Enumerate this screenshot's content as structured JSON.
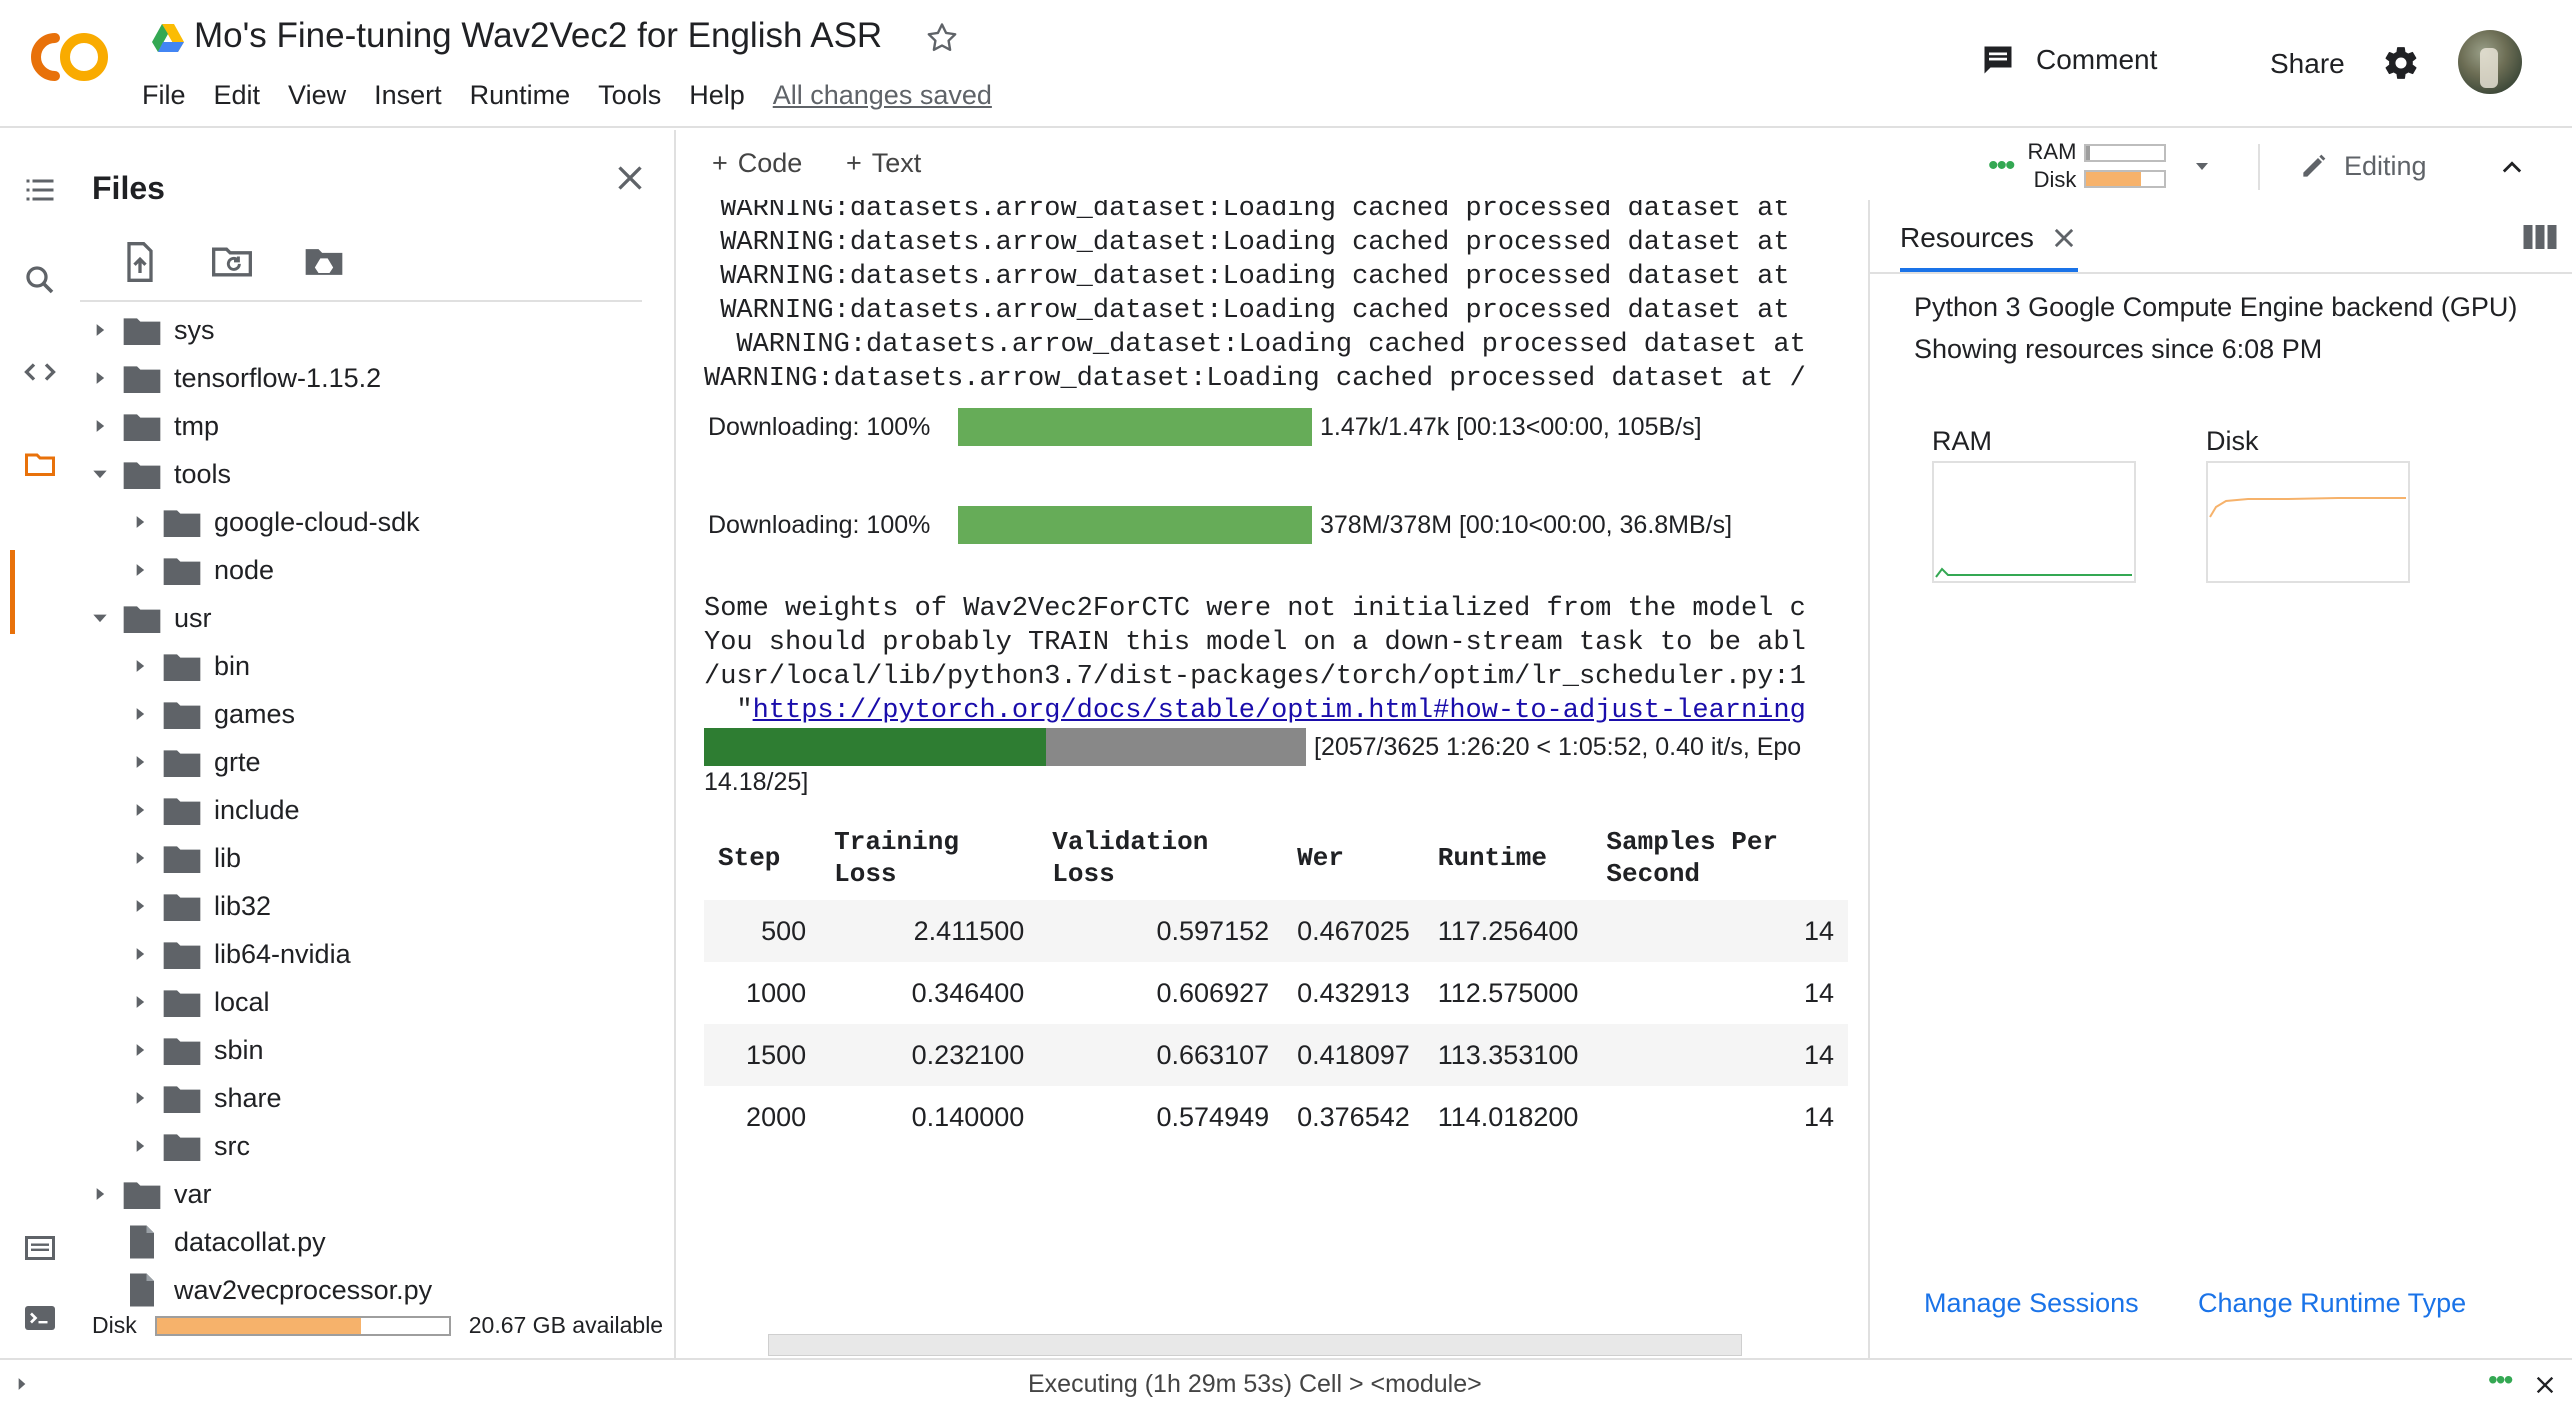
{
  "header": {
    "logo": "colab-logo",
    "title": "Mo's Fine-tuning Wav2Vec2 for English ASR",
    "menu": [
      "File",
      "Edit",
      "View",
      "Insert",
      "Runtime",
      "Tools",
      "Help"
    ],
    "save_status": "All changes saved",
    "comment_label": "Comment",
    "share_label": "Share"
  },
  "files": {
    "title": "Files",
    "tree": [
      {
        "label": "sys",
        "depth": 0,
        "type": "folder",
        "state": "collapsed"
      },
      {
        "label": "tensorflow-1.15.2",
        "depth": 0,
        "type": "folder",
        "state": "collapsed"
      },
      {
        "label": "tmp",
        "depth": 0,
        "type": "folder",
        "state": "collapsed"
      },
      {
        "label": "tools",
        "depth": 0,
        "type": "folder",
        "state": "expanded"
      },
      {
        "label": "google-cloud-sdk",
        "depth": 1,
        "type": "folder",
        "state": "collapsed"
      },
      {
        "label": "node",
        "depth": 1,
        "type": "folder",
        "state": "collapsed"
      },
      {
        "label": "usr",
        "depth": 0,
        "type": "folder",
        "state": "expanded"
      },
      {
        "label": "bin",
        "depth": 1,
        "type": "folder",
        "state": "collapsed"
      },
      {
        "label": "games",
        "depth": 1,
        "type": "folder",
        "state": "collapsed"
      },
      {
        "label": "grte",
        "depth": 1,
        "type": "folder",
        "state": "collapsed"
      },
      {
        "label": "include",
        "depth": 1,
        "type": "folder",
        "state": "collapsed"
      },
      {
        "label": "lib",
        "depth": 1,
        "type": "folder",
        "state": "collapsed"
      },
      {
        "label": "lib32",
        "depth": 1,
        "type": "folder",
        "state": "collapsed"
      },
      {
        "label": "lib64-nvidia",
        "depth": 1,
        "type": "folder",
        "state": "collapsed"
      },
      {
        "label": "local",
        "depth": 1,
        "type": "folder",
        "state": "collapsed"
      },
      {
        "label": "sbin",
        "depth": 1,
        "type": "folder",
        "state": "collapsed"
      },
      {
        "label": "share",
        "depth": 1,
        "type": "folder",
        "state": "collapsed"
      },
      {
        "label": "src",
        "depth": 1,
        "type": "folder",
        "state": "collapsed"
      },
      {
        "label": "var",
        "depth": 0,
        "type": "folder",
        "state": "collapsed"
      },
      {
        "label": "datacollat.py",
        "depth": 0,
        "type": "file"
      },
      {
        "label": "wav2vecprocessor.py",
        "depth": 0,
        "type": "file"
      }
    ],
    "disk_label": "Disk",
    "disk_used_fraction": 0.7,
    "disk_available": "20.67 GB available"
  },
  "toolbar": {
    "add_code": "Code",
    "add_text": "Text",
    "ram_label": "RAM",
    "disk_label": "Disk",
    "ram_fraction": 0.05,
    "disk_fraction": 0.7,
    "editing_label": "Editing"
  },
  "output": {
    "warnings": [
      " WARNING:datasets.arrow_dataset:Loading cached processed dataset at",
      " WARNING:datasets.arrow_dataset:Loading cached processed dataset at",
      " WARNING:datasets.arrow_dataset:Loading cached processed dataset at",
      " WARNING:datasets.arrow_dataset:Loading cached processed dataset at",
      "  WARNING:datasets.arrow_dataset:Loading cached processed dataset at",
      "WARNING:datasets.arrow_dataset:Loading cached processed dataset at /"
    ],
    "downloads": [
      {
        "label": "Downloading: 100%",
        "fraction": 1.0,
        "info": "1.47k/1.47k [00:13<00:00, 105B/s]"
      },
      {
        "label": "Downloading: 100%",
        "fraction": 1.0,
        "info": "378M/378M [00:10<00:00, 36.8MB/s]"
      }
    ],
    "messages": [
      "Some weights of Wav2Vec2ForCTC were not initialized from the model c",
      "You should probably TRAIN this model on a down-stream task to be abl",
      "/usr/local/lib/python3.7/dist-packages/torch/optim/lr_scheduler.py:1"
    ],
    "link_prefix": "  \"",
    "link_text": "https://pytorch.org/docs/stable/optim.html#how-to-adjust-learning",
    "train_progress_fraction": 0.5674,
    "train_progress_text": "[2057/3625 1:26:20 < 1:05:52, 0.40 it/s, Epo",
    "train_epoch_text": "14.18/25]",
    "table_headers": [
      "Step",
      "Training\nLoss",
      "Validation\nLoss",
      "Wer",
      "Runtime",
      "Samples Per\nSecond"
    ],
    "table_rows": [
      [
        "500",
        "2.411500",
        "0.597152",
        "0.467025",
        "117.256400",
        "14"
      ],
      [
        "1000",
        "0.346400",
        "0.606927",
        "0.432913",
        "112.575000",
        "14"
      ],
      [
        "1500",
        "0.232100",
        "0.663107",
        "0.418097",
        "113.353100",
        "14"
      ],
      [
        "2000",
        "0.140000",
        "0.574949",
        "0.376542",
        "114.018200",
        "14"
      ]
    ]
  },
  "resources": {
    "tab_label": "Resources",
    "backend": "Python 3 Google Compute Engine backend (GPU)",
    "since": "Showing resources since 6:08 PM",
    "ram_label": "RAM",
    "disk_label": "Disk",
    "ram_color": "#34a853",
    "disk_color": "#f6b26b",
    "manage_sessions": "Manage Sessions",
    "change_runtime": "Change Runtime Type"
  },
  "status": {
    "text": "Executing (1h 29m 53s)  Cell > <module>"
  }
}
